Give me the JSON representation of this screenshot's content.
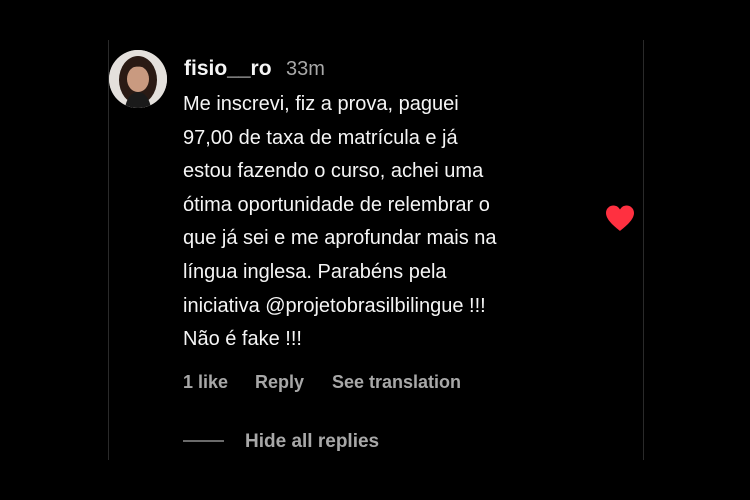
{
  "comment": {
    "username": "fisio__ro",
    "time": "33m",
    "text_lines": [
      "Me inscrevi, fiz a prova, paguei",
      "97,00 de taxa de matrícula e já",
      "estou fazendo o curso, achei uma",
      "ótima oportunidade de relembrar o",
      "que já sei e me aprofundar mais na",
      "língua inglesa. Parabéns pela",
      "iniciativa @projetobrasilbilingue !!!",
      "Não é fake !!!"
    ],
    "liked": true,
    "heart_color": "#ff3040"
  },
  "actions": {
    "likes": "1 like",
    "reply": "Reply",
    "translate": "See translation"
  },
  "replies": {
    "hide_label": "Hide all replies"
  }
}
